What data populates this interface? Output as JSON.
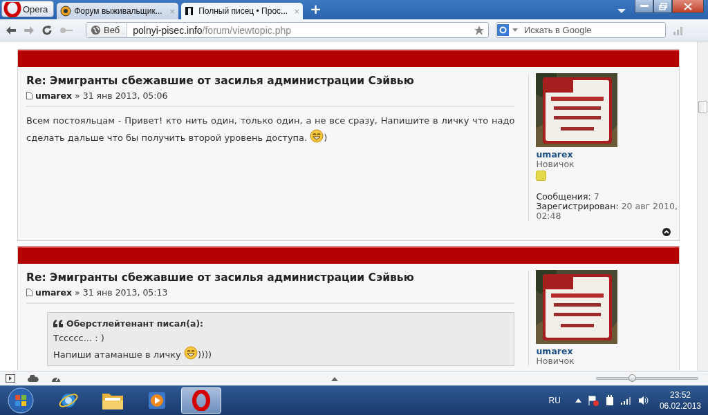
{
  "browser": {
    "menu_button": "Opera",
    "tabs": [
      {
        "title": "Форум выживальщик...",
        "close": "×",
        "selected": false
      },
      {
        "title": "Полный писец • Прос...",
        "close": "×",
        "selected": true
      }
    ],
    "new_tab": "+"
  },
  "toolbar": {
    "scope": "Веб",
    "url_host": "polnyi-pisec.info",
    "url_path": "/forum/viewtopic.php",
    "search_placeholder": "Искать в Google"
  },
  "posts": [
    {
      "title": "Re: Эмигранты сбежавшие от засилья администрации Сэйвью",
      "author": "umarex",
      "separator": "»",
      "date": "31 янв 2013, 05:06",
      "body": [
        {
          "kind": "paragraph",
          "parts": [
            {
              "kind": "text",
              "text": "Всем постояльцам - Привет! кто нить один, только один, а не все сразу, Напишите в личку что надо сделать дальше что бы получить второй уровень доступа. "
            },
            {
              "kind": "smiley"
            },
            {
              "kind": "text",
              "text": ")"
            }
          ]
        }
      ],
      "profile": {
        "name": "umarex",
        "rank": "Новичок",
        "rank_icon": true,
        "stats": [
          {
            "label": "Сообщения:",
            "value": "7"
          },
          {
            "label": "Зарегистрирован:",
            "value": "20 авг 2010, 02:48"
          }
        ]
      },
      "top_link": true
    },
    {
      "title": "Re: Эмигранты сбежавшие от засилья администрации Сэйвью",
      "author": "umarex",
      "separator": "»",
      "date": "31 янв 2013, 05:13",
      "body": [
        {
          "kind": "quote",
          "cite": "Оберстлейтенант писал(а):",
          "lines": [
            {
              "parts": [
                {
                  "kind": "text",
                  "text": "Тссссс... : )"
                }
              ]
            },
            {
              "parts": [
                {
                  "kind": "text",
                  "text": "Напиши атаманше в личку "
                },
                {
                  "kind": "smiley"
                },
                {
                  "kind": "text",
                  "text": "))))"
                }
              ]
            }
          ]
        }
      ],
      "profile": {
        "name": "umarex",
        "rank": "Новичок"
      }
    }
  ],
  "status_bar": {
    "zoom": {
      "level": 0.35
    }
  },
  "taskbar": {
    "apps": [
      {
        "kind": "ie",
        "selected": false
      },
      {
        "kind": "explorer",
        "selected": false
      },
      {
        "kind": "media",
        "selected": false
      },
      {
        "kind": "opera",
        "selected": true
      }
    ],
    "language": "RU",
    "time": "23:52",
    "date": "06.02.2013"
  }
}
